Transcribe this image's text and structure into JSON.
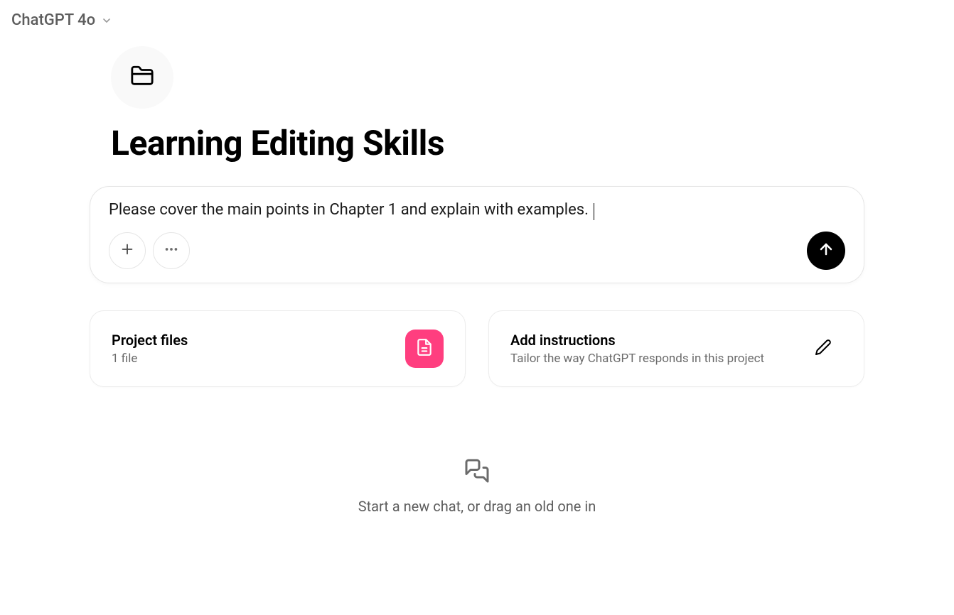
{
  "header": {
    "model_label": "ChatGPT 4o"
  },
  "project": {
    "title": "Learning Editing Skills"
  },
  "composer": {
    "text": "Please cover the main points in Chapter 1 and explain with examples. "
  },
  "cards": {
    "project_files": {
      "title": "Project files",
      "subtitle": "1 file"
    },
    "instructions": {
      "title": "Add instructions",
      "subtitle": "Tailor the way ChatGPT responds in this project"
    }
  },
  "empty_state": {
    "text": "Start a new chat, or drag an old one in"
  }
}
